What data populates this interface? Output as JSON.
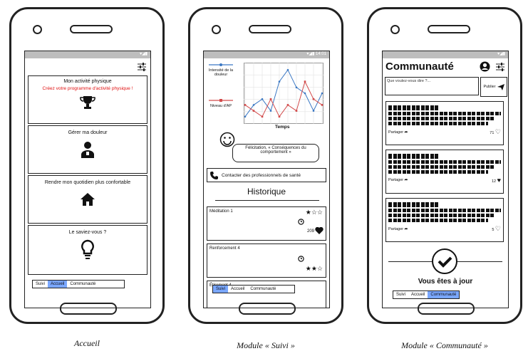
{
  "screens": {
    "accueil": {
      "caption": "Accueil",
      "cards": [
        {
          "title": "Mon activité physique",
          "subtitle": "Créez votre programme d'activité physique !",
          "icon": "trophy-icon"
        },
        {
          "title": "Gérer ma douleur",
          "icon": "doctor-icon"
        },
        {
          "title": "Rendre mon quotidien plus confortable",
          "icon": "house-icon"
        },
        {
          "title": "Le saviez-vous ?",
          "icon": "lightbulb-icon"
        }
      ],
      "tabs": [
        "Suivi",
        "Accueil",
        "Communauté"
      ],
      "active_tab": "Accueil"
    },
    "suivi": {
      "caption": "Module « Suivi »",
      "legend": [
        "Intensité de la douleur",
        "Niveau d'AP"
      ],
      "chart_xlabel": "Temps",
      "feedback": "Félicitation, « Conséquences du comportement »",
      "contact_label": "Contacter des professionnels de santé",
      "history_title": "Historique",
      "history": [
        {
          "title": "Méditation 1",
          "count": "209"
        },
        {
          "title": "Renforcement 4",
          "count": ""
        },
        {
          "title": "Étirement 4",
          "count": ""
        }
      ],
      "tabs": [
        "Suivi",
        "Accueil",
        "Communauté"
      ],
      "active_tab": "Suivi"
    },
    "communaute": {
      "caption": "Module « Communauté »",
      "title": "Communauté",
      "post_placeholder": "Que voulez-vous dire ?...",
      "publish_label": "Publier",
      "posts": [
        {
          "share_label": "Partager",
          "likes": "71"
        },
        {
          "share_label": "Partager",
          "likes": "12"
        },
        {
          "share_label": "Partager",
          "likes": "5"
        }
      ],
      "up_to_date": "Vous êtes à jour",
      "tabs": [
        "Suivi",
        "Accueil",
        "Communauté"
      ],
      "active_tab": "Communauté"
    }
  },
  "chart_data": {
    "type": "line",
    "x": [
      1,
      2,
      3,
      4,
      5,
      6,
      7,
      8,
      9,
      10
    ],
    "series": [
      {
        "name": "Intensité de la douleur",
        "color": "#3b78c4",
        "values": [
          1,
          3,
          4,
          2,
          7,
          9,
          6,
          5,
          2,
          5
        ]
      },
      {
        "name": "Niveau d'AP",
        "color": "#d24a4a",
        "values": [
          3,
          2,
          1,
          4,
          1,
          3,
          2,
          7,
          4,
          3
        ]
      }
    ],
    "xlabel": "Temps",
    "ylim": [
      0,
      10
    ]
  }
}
